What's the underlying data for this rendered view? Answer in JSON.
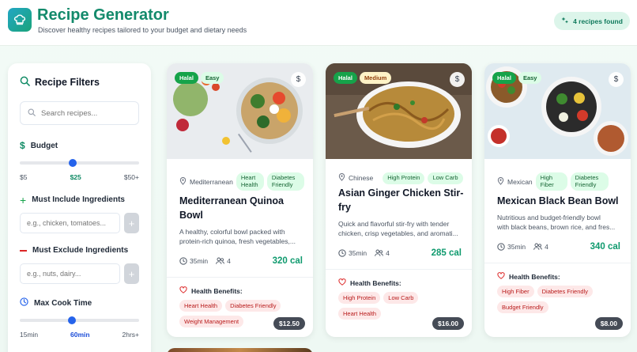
{
  "header": {
    "title": "Recipe Generator",
    "subtitle": "Discover healthy recipes tailored to your budget and dietary needs",
    "found_badge": "4 recipes found"
  },
  "sidebar": {
    "title": "Recipe Filters",
    "search_placeholder": "Search recipes...",
    "budget": {
      "label": "Budget",
      "min": "$5",
      "value": "$25",
      "max": "$50+",
      "level": 0.44
    },
    "include": {
      "label": "Must Include Ingredients",
      "placeholder": "e.g., chicken, tomatoes...",
      "add": "+"
    },
    "exclude": {
      "label": "Must Exclude Ingredients",
      "placeholder": "e.g., nuts, dairy...",
      "add": "+"
    },
    "cook_time": {
      "label": "Max Cook Time",
      "min": "15min",
      "value": "60min",
      "max": "2hrs+",
      "level": 0.43
    }
  },
  "recipes": [
    {
      "halal": "Halal",
      "difficulty": "Easy",
      "price": "$12.50",
      "cuisine": "Mediterranean",
      "chips": [
        "Heart Health",
        "Diabetes Friendly"
      ],
      "title_line1": "Mediterranean Quinoa",
      "title_line2": "Bowl",
      "desc_line1": "A healthy, colorful bowl packed with",
      "desc_line2": "protein-rich quinoa, fresh vegetables,...",
      "time": "35min",
      "servings": "4",
      "calories": "320 cal",
      "benefits_label": "Health Benefits:",
      "benefits": [
        "Heart Health",
        "Diabetes Friendly",
        "Weight Management"
      ]
    },
    {
      "halal": "Halal",
      "difficulty": "Medium",
      "price": "$16.00",
      "cuisine": "Chinese",
      "chips": [
        "High Protein",
        "Low Carb"
      ],
      "title_line1": "Asian Ginger Chicken Stir-",
      "title_line2": "fry",
      "desc_line1": "Quick and flavorful stir-fry with tender",
      "desc_line2": "chicken, crisp vegetables, and aromati...",
      "time": "35min",
      "servings": "4",
      "calories": "285 cal",
      "benefits_label": "Health Benefits:",
      "benefits": [
        "High Protein",
        "Low Carb",
        "Heart Health"
      ]
    },
    {
      "halal": "Halal",
      "difficulty": "Easy",
      "price": "$8.00",
      "cuisine": "Mexican",
      "chips": [
        "High Fiber",
        "Diabetes Friendly"
      ],
      "title_line1": "Mexican Black Bean Bowl",
      "title_line2": "",
      "desc_line1": "Nutritious and budget-friendly bowl",
      "desc_line2": "with black beans, brown rice, and fres...",
      "time": "35min",
      "servings": "4",
      "calories": "340 cal",
      "benefits_label": "Health Benefits:",
      "benefits": [
        "High Fiber",
        "Diabetes Friendly",
        "Budget Friendly"
      ]
    }
  ]
}
